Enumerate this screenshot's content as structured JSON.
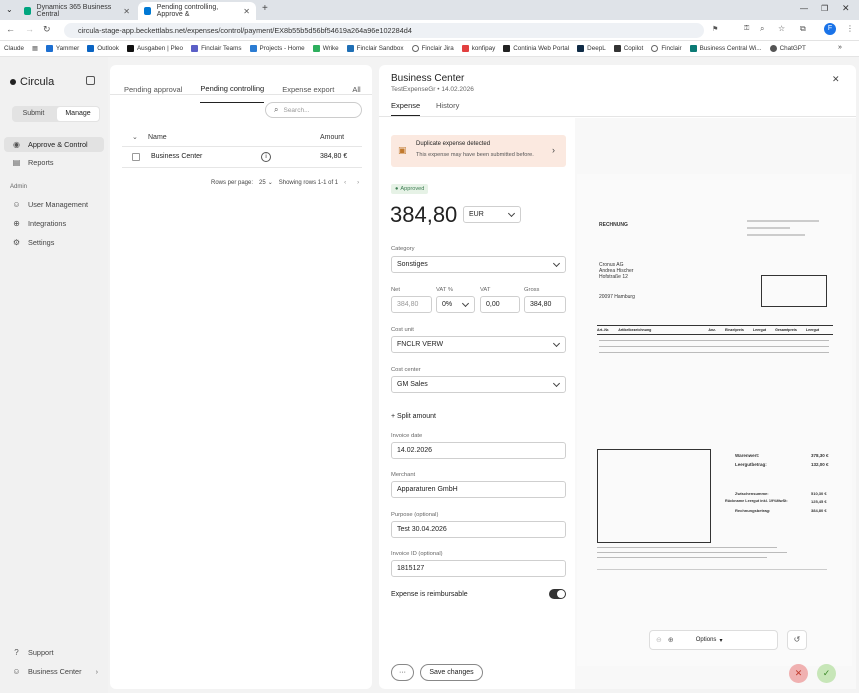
{
  "browser": {
    "tabs": [
      {
        "title": "Dynamics 365 Business Central",
        "active": false
      },
      {
        "title": "Pending controlling, Approve &",
        "active": true
      }
    ],
    "url": "circula-stage-app.beckettlabs.net/expenses/control/payment/EX8b55b5d56bf54619a264a96e102284d4",
    "bookmarks": [
      "Claude",
      "Yammer",
      "Outlook",
      "Ausgaben | Pleo",
      "Finclair Teams",
      "Projects - Home",
      "Wrike",
      "Finclair Sandbox",
      "Finclair Jira",
      "konfipay",
      "Continia Web Portal",
      "DeepL",
      "Copilot",
      "Finclair",
      "Business Central Wi...",
      "ChatGPT"
    ],
    "avatar_letter": "F"
  },
  "sidebar": {
    "logo": "Circula",
    "submit_label": "Submit",
    "manage_label": "Manage",
    "items": [
      {
        "label": "Approve & Control",
        "icon": "check-circle-icon",
        "selected": true
      },
      {
        "label": "Reports",
        "icon": "chart-icon",
        "selected": false
      }
    ],
    "admin_heading": "Admin",
    "admin_items": [
      {
        "label": "User Management",
        "icon": "user-icon"
      },
      {
        "label": "Integrations",
        "icon": "plug-icon"
      },
      {
        "label": "Settings",
        "icon": "gear-icon"
      }
    ],
    "support_label": "Support",
    "account_label": "Business Center"
  },
  "list": {
    "tabs": [
      "Pending approval",
      "Pending controlling",
      "Expense export",
      "All"
    ],
    "active_tab": 1,
    "search_placeholder": "Search...",
    "col_name": "Name",
    "col_amount": "Amount",
    "rows": [
      {
        "name": "Business Center",
        "amount": "384,80 €"
      }
    ],
    "rows_per_page_label": "Rows per page:",
    "rows_per_page": "25",
    "showing": "Showing rows 1-1 of 1"
  },
  "detail": {
    "title": "Business Center",
    "subtitle": "TestExpenseGr • 14.02.2026",
    "tabs": [
      "Expense",
      "History"
    ],
    "duplicate_title": "Duplicate expense detected",
    "duplicate_text": "This expense may have been submitted before.",
    "status": "Approved",
    "amount": "384,80",
    "currency": "EUR",
    "category_label": "Category",
    "category": "Sonstiges",
    "net_label": "Net",
    "net": "384,80",
    "vat_pct_label": "VAT %",
    "vat_pct": "0%",
    "vat_label": "VAT",
    "vat": "0,00",
    "gross_label": "Gross",
    "gross": "384,80",
    "cost_unit_label": "Cost unit",
    "cost_unit": "FNCLR VERW",
    "cost_center_label": "Cost center",
    "cost_center": "GM Sales",
    "split_label": "+ Split amount",
    "invoice_date_label": "Invoice date",
    "invoice_date": "14.02.2026",
    "merchant_label": "Merchant",
    "merchant": "Apparaturen GmbH",
    "purpose_label": "Purpose (optional)",
    "purpose": "Test 30.04.2026",
    "invoice_id_label": "Invoice ID (optional)",
    "invoice_id": "1815127",
    "reimbursable_label": "Expense is reimbursable",
    "reimbursable": true,
    "more_label": "···",
    "save_label": "Save changes",
    "options_label": "Options"
  },
  "receipt": {
    "heading": "RECHNUNG",
    "recipient": [
      "Cronus AG",
      "Andrea Hischer",
      "Hofstraße 12",
      "",
      "20097 Hamburg"
    ],
    "table_headers": [
      "Art.-Nr.",
      "Artikelbezeichnung",
      "Anz.",
      "Einzelpreis",
      "Leergut",
      "Gesamtpreis",
      "Leergut"
    ],
    "totals": [
      {
        "label": "Warenwert:",
        "value": "378,30 €"
      },
      {
        "label": "Leergutbetrag:",
        "value": "132,00 €"
      },
      {
        "label": "Zwischensumme:",
        "value": "510,30 €"
      },
      {
        "label": "Rückname Leergut inkl. 19%MwSt:",
        "value": "125,45 €"
      },
      {
        "label": "Rechnungsbetrag:",
        "value": "384,80 €"
      }
    ]
  },
  "colors": {
    "accent": "#3c7d52",
    "warning_bg": "#fbe9e0",
    "approve": "#7dc06a",
    "reject": "#e06b6b"
  }
}
